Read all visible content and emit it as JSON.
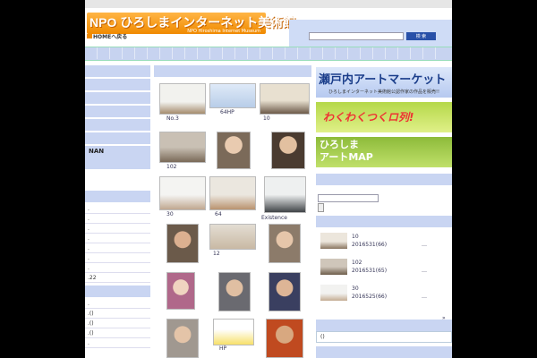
{
  "header": {
    "logo_text": "NPO ひろしまインターネット美術館",
    "logo_sub": "NPO Hiroshima Internet Museum",
    "home_link": "HOMEへ戻る",
    "search_button": "検 索"
  },
  "left_sidebar": {
    "heading": "NAN",
    "items": [
      ".",
      ".",
      ".",
      ".",
      ".",
      ".",
      ".",
      ".22"
    ],
    "items2": [
      ".",
      ".()",
      ".()",
      ".()",
      "."
    ]
  },
  "gallery": {
    "labels": [
      "No.3",
      "64HP",
      "10",
      "102",
      "30",
      "64",
      "Existence",
      "12",
      "HP"
    ]
  },
  "right_sidebar": {
    "banner1_title": "瀬戸内アートマーケット",
    "banner1_sub": "ひろしまインターネット美術館公認作家の作品を販売!!",
    "banner2_title": "わくわくつくロ列!",
    "banner3_line1": "ひろしま",
    "banner3_line2": "アートMAP",
    "posts": [
      {
        "title": "10",
        "date": "2016531(66)",
        "more": "…"
      },
      {
        "title": "102",
        "date": "2016531(65)",
        "more": "…"
      },
      {
        "title": "30",
        "date": "2016525(66)",
        "more": "…"
      }
    ],
    "more_arrow": "»",
    "bottom_box": "()"
  },
  "colors": {
    "accent_orange": "#f08a00",
    "nav_blue": "#c9d5f2",
    "search_blue": "#2850a8"
  }
}
